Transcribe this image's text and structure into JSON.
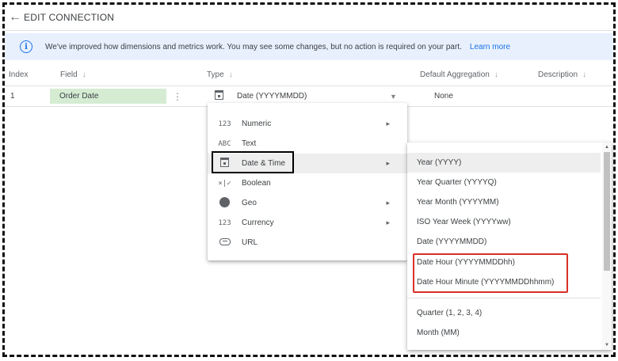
{
  "topbar": {
    "back_icon": "arrow-left-icon",
    "title": "EDIT CONNECTION"
  },
  "banner": {
    "message": "We've improved how dimensions and metrics work. You may see some changes, but no action is required on your part.",
    "link": "Learn more",
    "icon": "info-icon",
    "background": "#e8f0fe",
    "accent": "#1a73e8"
  },
  "table": {
    "headers": {
      "index": "Index",
      "field": "Field",
      "type": "Type",
      "aggregation": "Default Aggregation",
      "description": "Description"
    },
    "row": {
      "index": "1",
      "field": "Order Date",
      "type": "Date (YYYYMMDD)",
      "aggregation": "None",
      "field_chip_color": "#d5ecd3"
    }
  },
  "type_menu": {
    "items": [
      {
        "icon_text": "123",
        "icon": "numeric-icon",
        "label": "Numeric",
        "submenu": true
      },
      {
        "icon_text": "ABC",
        "icon": "text-icon",
        "label": "Text",
        "submenu": false
      },
      {
        "icon_text": "",
        "icon": "calendar-icon",
        "label": "Date & Time",
        "submenu": true,
        "active": true
      },
      {
        "icon_text": "×|✓",
        "icon": "boolean-icon",
        "label": "Boolean",
        "submenu": false
      },
      {
        "icon_text": "",
        "icon": "globe-icon",
        "label": "Geo",
        "submenu": true
      },
      {
        "icon_text": "123",
        "icon": "currency-icon",
        "label": "Currency",
        "submenu": true
      },
      {
        "icon_text": "",
        "icon": "link-icon",
        "label": "URL",
        "submenu": false
      }
    ]
  },
  "date_menu": {
    "items": [
      {
        "label": "Year (YYYY)",
        "active": true
      },
      {
        "label": "Year Quarter (YYYYQ)"
      },
      {
        "label": "Year Month (YYYYMM)"
      },
      {
        "label": "ISO Year Week (YYYYww)"
      },
      {
        "label": "Date (YYYYMMDD)"
      },
      {
        "label": "Date Hour (YYYYMMDDhh)"
      },
      {
        "label": "Date Hour Minute (YYYYMMDDhhmm)"
      },
      {
        "label": "Quarter (1, 2, 3, 4)"
      },
      {
        "label": "Month (MM)"
      }
    ]
  },
  "highlights": {
    "black_box_color": "#000000",
    "red_box_color": "#d93025"
  }
}
